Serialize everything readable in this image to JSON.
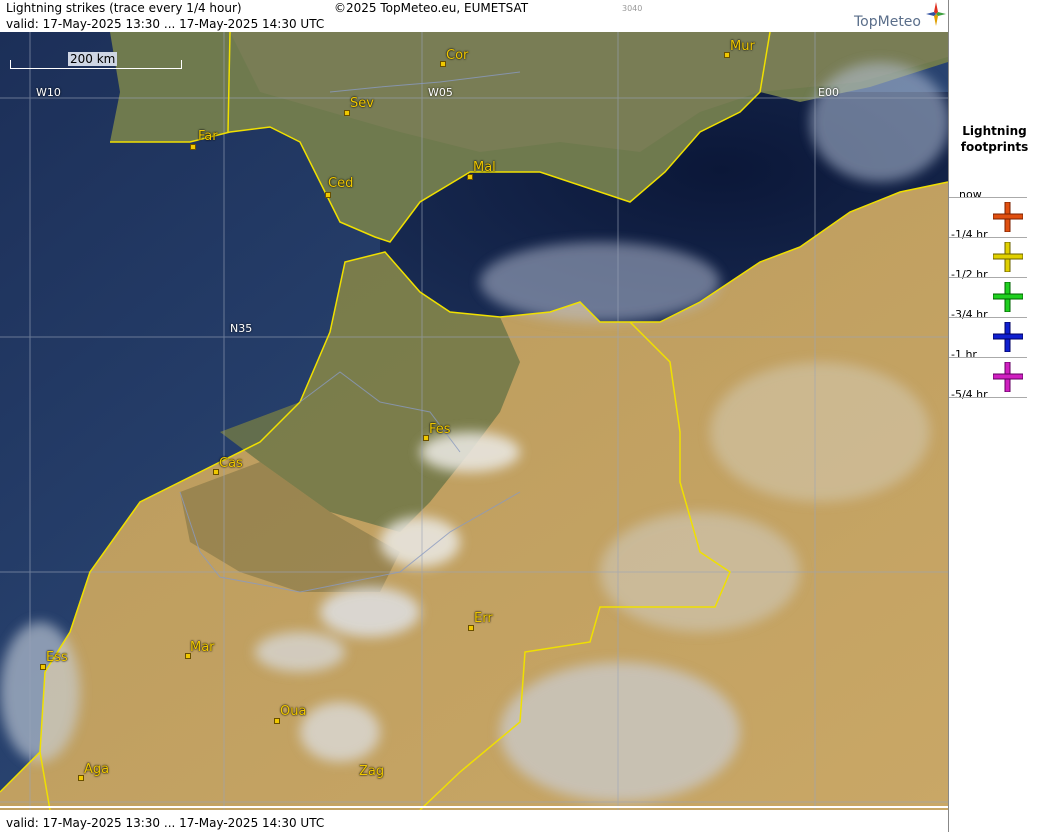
{
  "header": {
    "title": "Lightning strikes (trace every 1/4 hour)",
    "copyright": "©2025 TopMeteo.eu, EUMETSAT",
    "code": "3040",
    "valid": "valid:  17-May-2025 13:30 ... 17-May-2025 14:30 UTC",
    "logo": "TopMeteo"
  },
  "footer": {
    "valid": "valid:  17-May-2025 13:30 ... 17-May-2025 14:30 UTC"
  },
  "map": {
    "scale_label": "200 km",
    "grid_labels": [
      "W10",
      "W05",
      "E00",
      "N35"
    ],
    "cities": [
      {
        "name": "Cor"
      },
      {
        "name": "Mur"
      },
      {
        "name": "Sev"
      },
      {
        "name": "Far"
      },
      {
        "name": "Mal"
      },
      {
        "name": "Ced"
      },
      {
        "name": "Fes"
      },
      {
        "name": "Cas"
      },
      {
        "name": "Err"
      },
      {
        "name": "Mar"
      },
      {
        "name": "Ess"
      },
      {
        "name": "Oua"
      },
      {
        "name": "Aga"
      },
      {
        "name": "Zag"
      }
    ],
    "colors": {
      "sea": "#0d1a3a",
      "land": "#b89a5e",
      "green": "#5e7040",
      "border": "#f0e000",
      "city": "#f0c800"
    }
  },
  "legend": {
    "title_line1": "Lightning",
    "title_line2": "footprints",
    "items": [
      {
        "label": "now",
        "color": "#e05010"
      },
      {
        "label": "-1/4 hr",
        "color": "#e0d000"
      },
      {
        "label": "-1/2 hr",
        "color": "#20d020"
      },
      {
        "label": "-3/4 hr",
        "color": "#1020d0"
      },
      {
        "label": "-1 hr",
        "color": "#d020c0"
      },
      {
        "label": "-5/4 hr",
        "color": ""
      }
    ]
  }
}
